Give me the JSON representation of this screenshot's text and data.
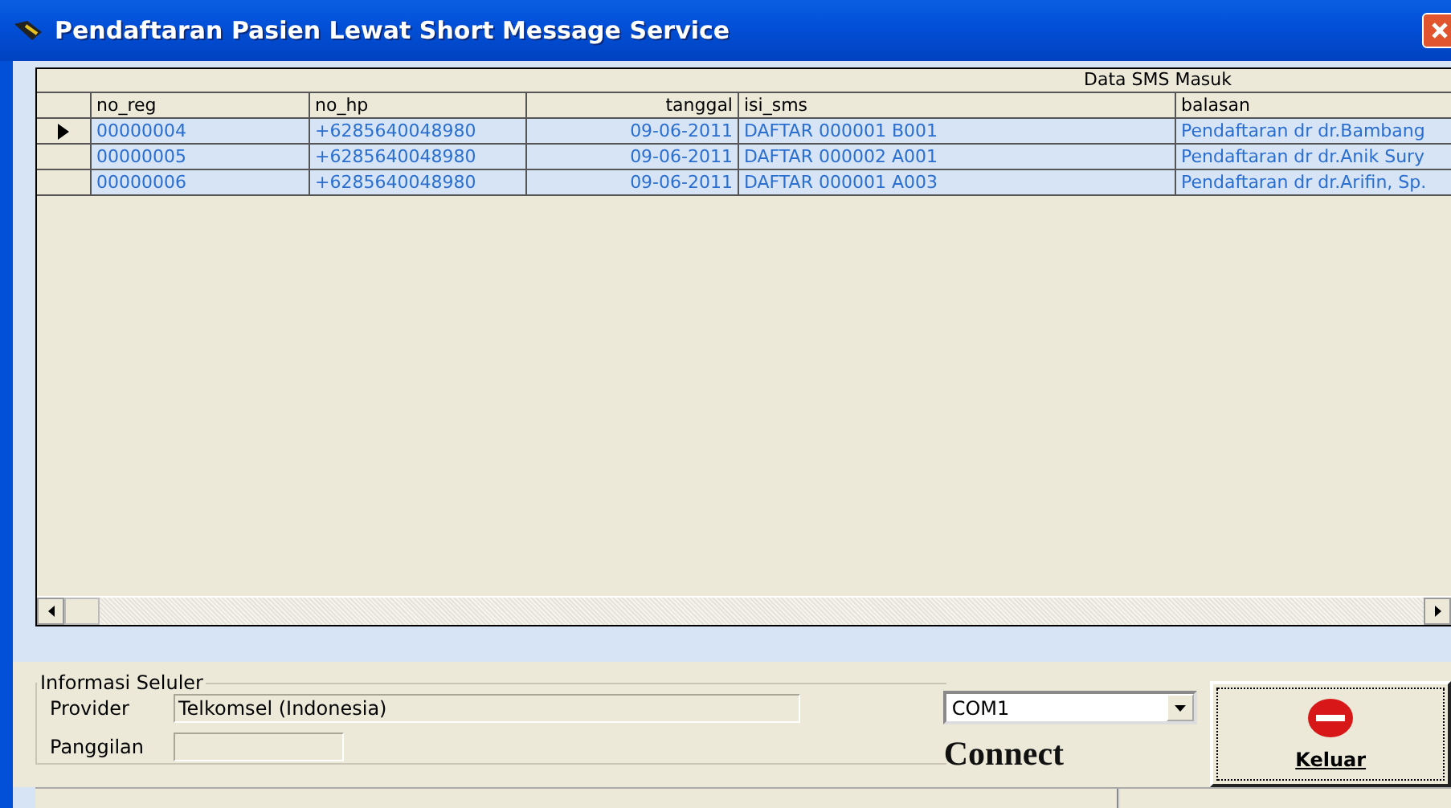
{
  "window": {
    "title": "Pendaftaran Pasien Lewat Short Message Service"
  },
  "grid": {
    "caption": "Data SMS Masuk",
    "columns": [
      "no_reg",
      "no_hp",
      "tanggal",
      "isi_sms",
      "balasan"
    ],
    "rows": [
      {
        "current": true,
        "cells": [
          "00000004",
          "+6285640048980",
          "09-06-2011",
          "DAFTAR 000001 B001",
          "Pendaftaran dr dr.Bambang"
        ]
      },
      {
        "current": false,
        "cells": [
          "00000005",
          "+6285640048980",
          "09-06-2011",
          "DAFTAR 000002 A001",
          "Pendaftaran dr dr.Anik Sury"
        ]
      },
      {
        "current": false,
        "cells": [
          "00000006",
          "+6285640048980",
          "09-06-2011",
          "DAFTAR 000001 A003",
          "Pendaftaran dr dr.Arifin, Sp."
        ]
      }
    ]
  },
  "cellular": {
    "title": "Informasi Seluler",
    "provider_label": "Provider",
    "provider_value": "Telkomsel (Indonesia)",
    "call_label": "Panggilan"
  },
  "port": {
    "value": "COM1"
  },
  "connect_label": "Connect",
  "exit_button": "Keluar"
}
